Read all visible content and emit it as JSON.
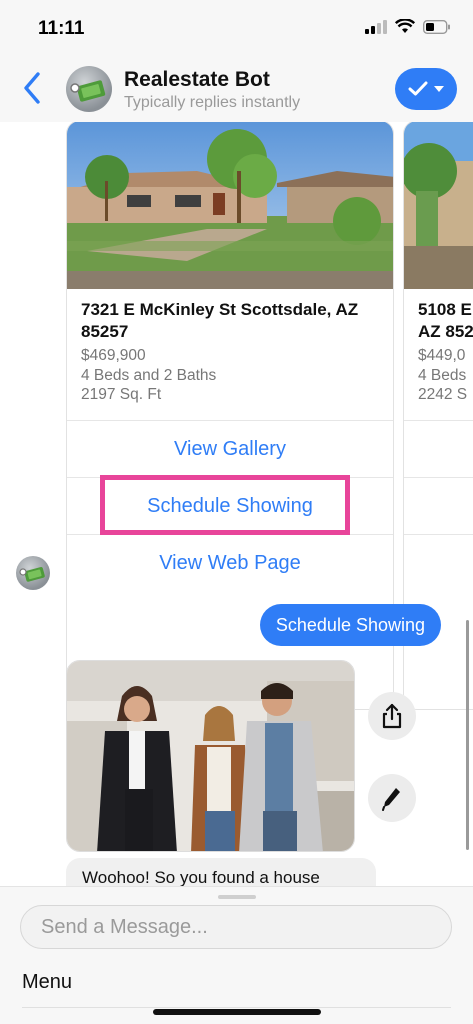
{
  "status_bar": {
    "time": "11:11"
  },
  "header": {
    "bot_name": "Realestate Bot",
    "subtitle": "Typically replies instantly"
  },
  "listing_card": {
    "title": "7321 E McKinley St Scottsdale, AZ 85257",
    "price": "$469,900",
    "beds_baths": "4 Beds and 2 Baths",
    "sqft": "2197 Sq. Ft",
    "buttons": [
      "View Gallery",
      "Schedule Showing",
      "View Web Page"
    ]
  },
  "listing_card_2": {
    "title": "5108 E\nAZ 852",
    "price": "$449,0",
    "beds_baths": "4 Beds",
    "sqft": "2242 S"
  },
  "user_message": "Schedule Showing",
  "bot_message": "Woohoo! So you found a house",
  "composer": {
    "placeholder": "Send a Message...",
    "menu_label": "Menu"
  },
  "colors": {
    "accent": "#2f7df6",
    "highlight": "#e8459a"
  },
  "icons": [
    "back-chevron-icon",
    "checkmark-icon",
    "caret-down-icon",
    "share-icon",
    "pencil-icon",
    "signal-icon",
    "wifi-icon",
    "battery-icon"
  ]
}
